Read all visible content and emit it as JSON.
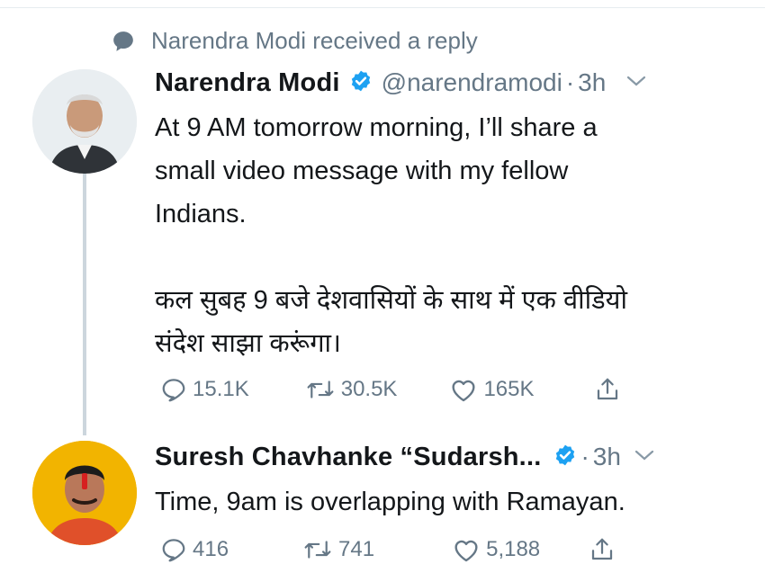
{
  "context_line": "Narendra Modi received a reply",
  "tweets": [
    {
      "name": "Narendra Modi",
      "handle": "@narendramodi",
      "separator": "·",
      "time": "3h",
      "text_lines_en": [
        "At 9 AM tomorrow morning, I’ll share a",
        "small video message with my fellow",
        "Indians."
      ],
      "text_lines_hi": [
        "कल सुबह 9 बजे देशवासियों के साथ में एक वीडियो",
        "संदेश साझा करूंगा।"
      ],
      "replies": "15.1K",
      "retweets": "30.5K",
      "likes": "165K"
    },
    {
      "name": "Suresh Chavhanke “Sudarsh...",
      "separator": "·",
      "time": "3h",
      "text": "Time, 9am is overlapping with Ramayan.",
      "replies": "416",
      "retweets": "741",
      "likes": "5,188"
    }
  ],
  "colors": {
    "verified": "#1da1f2",
    "secondary_text": "#657786",
    "thread_line": "#ccd6dd"
  },
  "icons": [
    "speech-bubble-icon",
    "verified-icon",
    "chevron-down-icon",
    "reply-icon",
    "retweet-icon",
    "like-icon",
    "share-icon"
  ]
}
